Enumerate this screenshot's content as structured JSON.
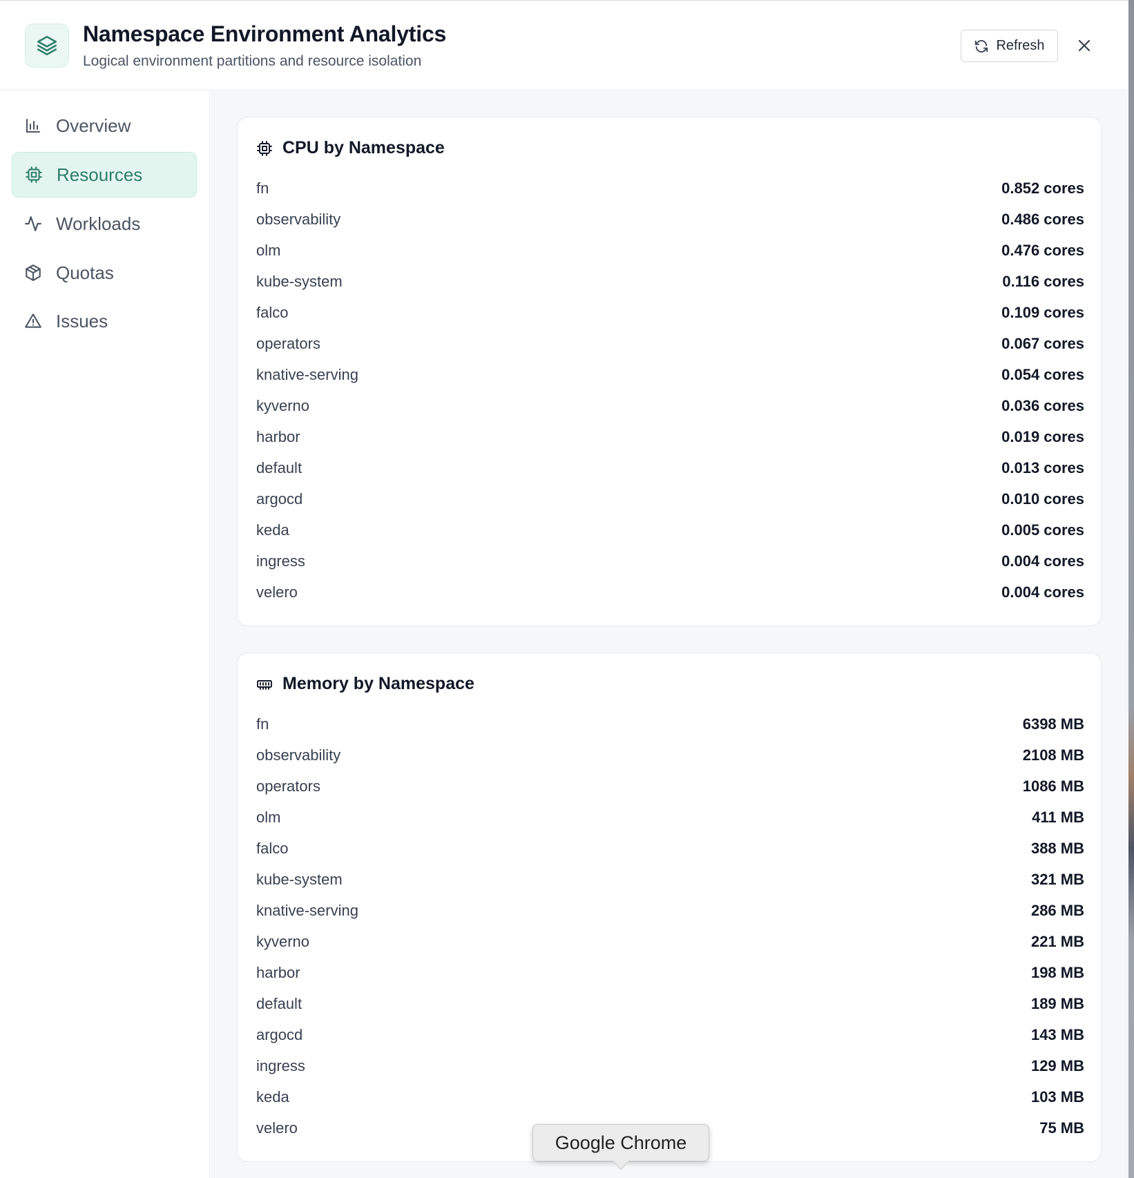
{
  "header": {
    "title": "Namespace Environment Analytics",
    "subtitle": "Logical environment partitions and resource isolation",
    "refresh_label": "Refresh",
    "logo_icon": "layers-icon",
    "accent_color": "#2f7d6b"
  },
  "sidebar": {
    "items": [
      {
        "label": "Overview",
        "icon": "bar-chart-icon",
        "active": false
      },
      {
        "label": "Resources",
        "icon": "cpu-icon",
        "active": true
      },
      {
        "label": "Workloads",
        "icon": "activity-icon",
        "active": false
      },
      {
        "label": "Quotas",
        "icon": "package-icon",
        "active": false
      },
      {
        "label": "Issues",
        "icon": "alert-triangle-icon",
        "active": false
      }
    ]
  },
  "cpu_card": {
    "title": "CPU by Namespace",
    "icon": "cpu-icon",
    "rows": [
      {
        "name": "fn",
        "value": "0.852 cores"
      },
      {
        "name": "observability",
        "value": "0.486 cores"
      },
      {
        "name": "olm",
        "value": "0.476 cores"
      },
      {
        "name": "kube-system",
        "value": "0.116 cores"
      },
      {
        "name": "falco",
        "value": "0.109 cores"
      },
      {
        "name": "operators",
        "value": "0.067 cores"
      },
      {
        "name": "knative-serving",
        "value": "0.054 cores"
      },
      {
        "name": "kyverno",
        "value": "0.036 cores"
      },
      {
        "name": "harbor",
        "value": "0.019 cores"
      },
      {
        "name": "default",
        "value": "0.013 cores"
      },
      {
        "name": "argocd",
        "value": "0.010 cores"
      },
      {
        "name": "keda",
        "value": "0.005 cores"
      },
      {
        "name": "ingress",
        "value": "0.004 cores"
      },
      {
        "name": "velero",
        "value": "0.004 cores"
      }
    ]
  },
  "memory_card": {
    "title": "Memory by Namespace",
    "icon": "memory-icon",
    "rows": [
      {
        "name": "fn",
        "value": "6398 MB"
      },
      {
        "name": "observability",
        "value": "2108 MB"
      },
      {
        "name": "operators",
        "value": "1086 MB"
      },
      {
        "name": "olm",
        "value": "411 MB"
      },
      {
        "name": "falco",
        "value": "388 MB"
      },
      {
        "name": "kube-system",
        "value": "321 MB"
      },
      {
        "name": "knative-serving",
        "value": "286 MB"
      },
      {
        "name": "kyverno",
        "value": "221 MB"
      },
      {
        "name": "harbor",
        "value": "198 MB"
      },
      {
        "name": "default",
        "value": "189 MB"
      },
      {
        "name": "argocd",
        "value": "143 MB"
      },
      {
        "name": "ingress",
        "value": "129 MB"
      },
      {
        "name": "keda",
        "value": "103 MB"
      },
      {
        "name": "velero",
        "value": "75 MB"
      }
    ]
  },
  "tooltip": {
    "text": "Google Chrome"
  }
}
